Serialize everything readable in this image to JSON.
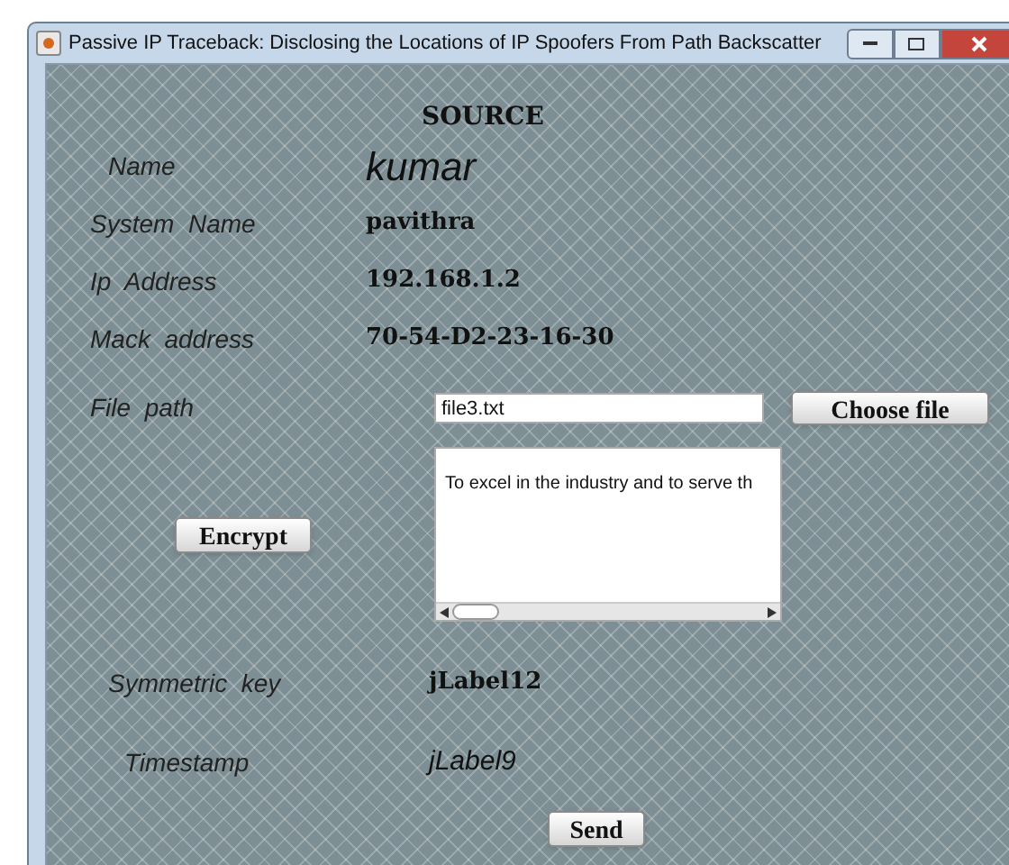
{
  "window": {
    "title": "Passive IP Traceback: Disclosing the Locations of IP Spoofers From Path Backscatter"
  },
  "heading": "SOURCE",
  "fields": [
    {
      "label": "Name",
      "value": "kumar",
      "kind": "large"
    },
    {
      "label": "System  Name",
      "value": "pavithra",
      "kind": "bold"
    },
    {
      "label": "Ip  Address",
      "value": "192.168.1.2",
      "kind": "bold"
    },
    {
      "label": "Mack  address",
      "value": "70-54-D2-23-16-30",
      "kind": "bold"
    }
  ],
  "file": {
    "label": "File  path",
    "value": "file3.txt",
    "button": "Choose file"
  },
  "encrypt_button": "Encrypt",
  "content": "To excel in the industry and to serve th",
  "results": [
    {
      "label": "Symmetric  key",
      "value": "jLabel12",
      "kind": "bold"
    },
    {
      "label": "Timestamp",
      "value": "jLabel9",
      "kind": "italic"
    }
  ],
  "send_button": "Send"
}
